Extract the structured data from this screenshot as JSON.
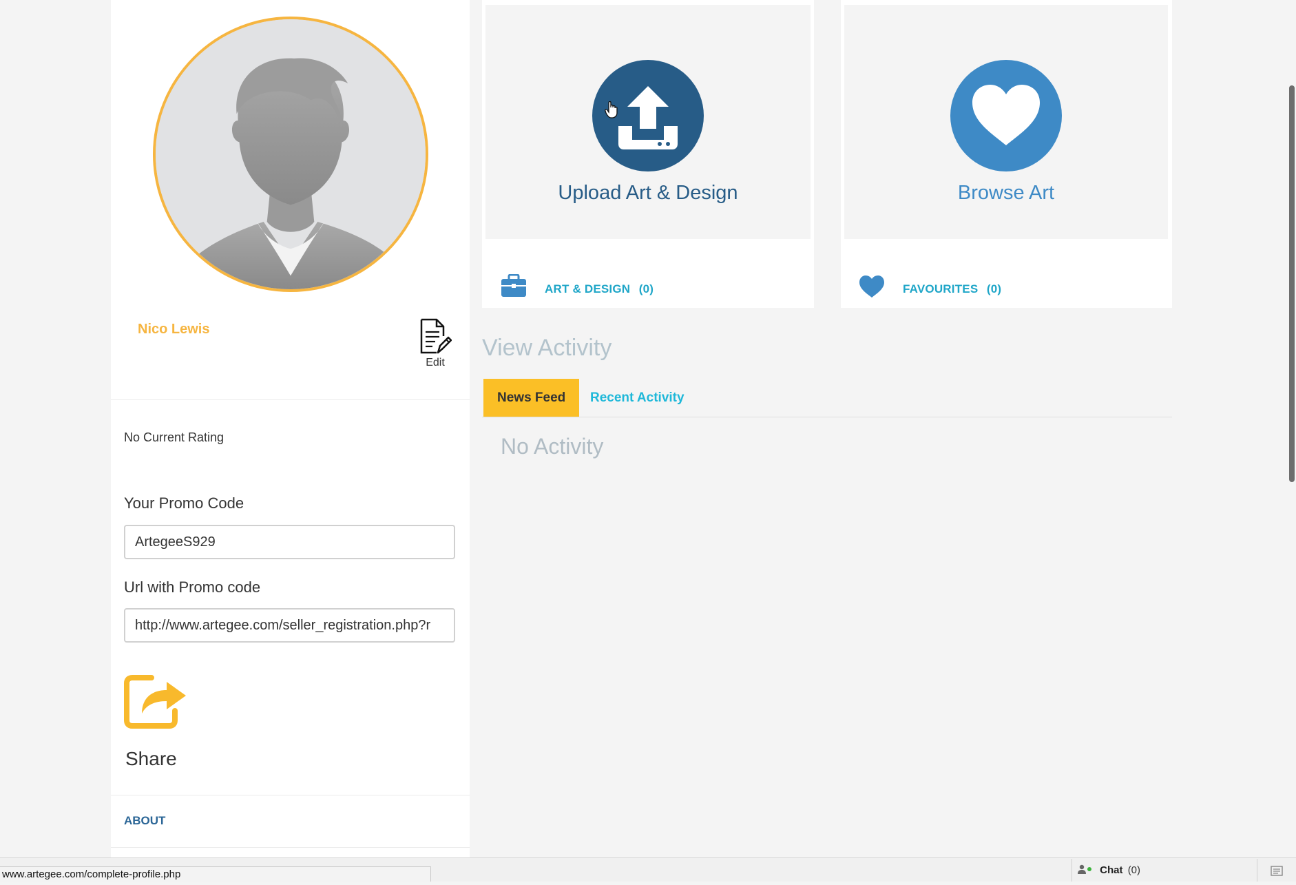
{
  "profile": {
    "name": "Nico Lewis",
    "edit_label": "Edit",
    "rating_text": "No Current Rating",
    "promo_label": "Your Promo Code",
    "promo_value": "ArtegeeS929",
    "url_label": "Url with Promo code",
    "url_value": "http://www.artegee.com/seller_registration.php?r",
    "share_label": "Share",
    "about_label": "ABOUT"
  },
  "cards": [
    {
      "title": "Upload Art & Design",
      "icon": "upload-icon",
      "color": "#275c87",
      "row_icon": "briefcase-icon",
      "row_label": "ART & DESIGN",
      "row_count": "(0)"
    },
    {
      "title": "Browse Art",
      "icon": "heart-icon",
      "color": "#3e8ac6",
      "row_icon": "heart-icon",
      "row_label": "FAVOURITES",
      "row_count": "(0)"
    }
  ],
  "activity": {
    "heading": "View Activity",
    "tabs": [
      {
        "label": "News Feed",
        "active": true
      },
      {
        "label": "Recent Activity",
        "active": false
      }
    ],
    "empty_text": "No Activity"
  },
  "status_bar": {
    "url": "www.artegee.com/complete-profile.php"
  },
  "chat": {
    "label": "Chat",
    "count": "(0)"
  },
  "colors": {
    "accent": "#f6b540",
    "tab_active": "#fbbf26",
    "link": "#1fa6c8",
    "dark_blue": "#275c87",
    "mid_blue": "#3e8ac6"
  }
}
